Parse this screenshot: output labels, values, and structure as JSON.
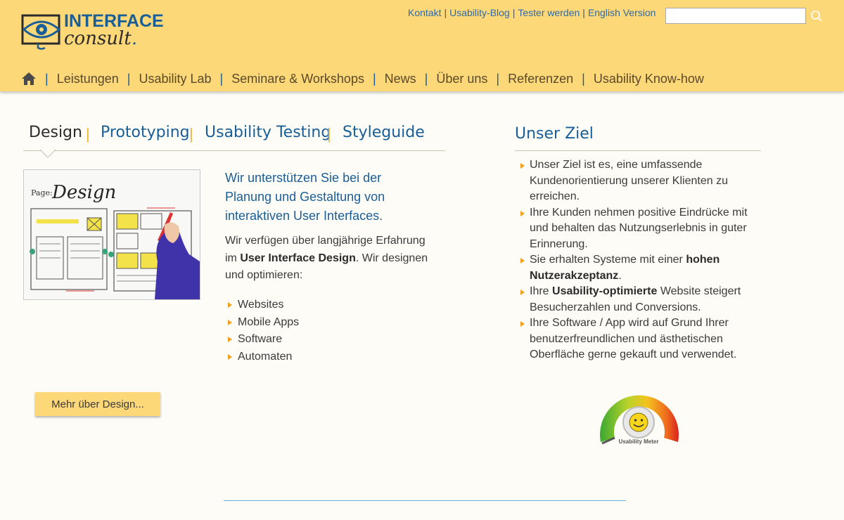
{
  "logo": {
    "line1": "INTERFACE",
    "line2": "consult",
    "dot": "."
  },
  "toplinks": [
    {
      "label": "Kontakt"
    },
    {
      "label": "Usability-Blog"
    },
    {
      "label": "Tester werden"
    },
    {
      "label": "English Version"
    }
  ],
  "search": {
    "value": "",
    "icon": "search-icon"
  },
  "mainnav": {
    "home_icon": "home-icon",
    "items": [
      {
        "label": "Leistungen"
      },
      {
        "label": "Usability Lab"
      },
      {
        "label": "Seminare & Workshops"
      },
      {
        "label": "News"
      },
      {
        "label": "Über uns"
      },
      {
        "label": "Referenzen"
      },
      {
        "label": "Usability Know-how"
      }
    ]
  },
  "tabs": [
    {
      "label": "Design",
      "active": true
    },
    {
      "label": "Prototyping",
      "active": false
    },
    {
      "label": "Usability Testing",
      "active": false
    },
    {
      "label": "Styleguide",
      "active": false
    }
  ],
  "design": {
    "image_label": "Page:",
    "image_title": "Design",
    "intro": "Wir unterstützen Sie bei der Planung und Gestaltung von interaktiven User Interfaces.",
    "body_1": "Wir verfügen über langjährige Erfahrung im ",
    "body_bold": "User Interface Design",
    "body_2": ". Wir designen und optimieren:",
    "bullets": [
      "Websites",
      "Mobile Apps",
      "Software",
      "Automaten"
    ],
    "button": "Mehr über Design..."
  },
  "sidebar": {
    "title": "Unser Ziel",
    "items": [
      {
        "text": "Unser Ziel ist es, eine umfassende Kundenorientierung unserer Klienten zu erreichen."
      },
      {
        "text": "Ihre Kunden nehmen positive Eindrücke mit und behalten das Nutzungserlebnis in guter Erinnerung."
      },
      {
        "pre": "Sie erhalten Systeme mit einer ",
        "bold": "hohen Nutzerakzeptanz",
        "post": "."
      },
      {
        "pre": "Ihre ",
        "bold": "Usability-optimierte",
        "post": " Website steigert Besucherzahlen und Conversions."
      },
      {
        "text": "Ihre Software / App wird auf Grund Ihrer benutzerfreundlichen und ästhetischen Oberfläche gerne gekauft und verwendet."
      }
    ],
    "meter_label": "Usability Meter"
  },
  "colors": {
    "header_bg": "#fdd878",
    "brand_blue": "#1a5e98",
    "accent_orange": "#f2a01e"
  }
}
